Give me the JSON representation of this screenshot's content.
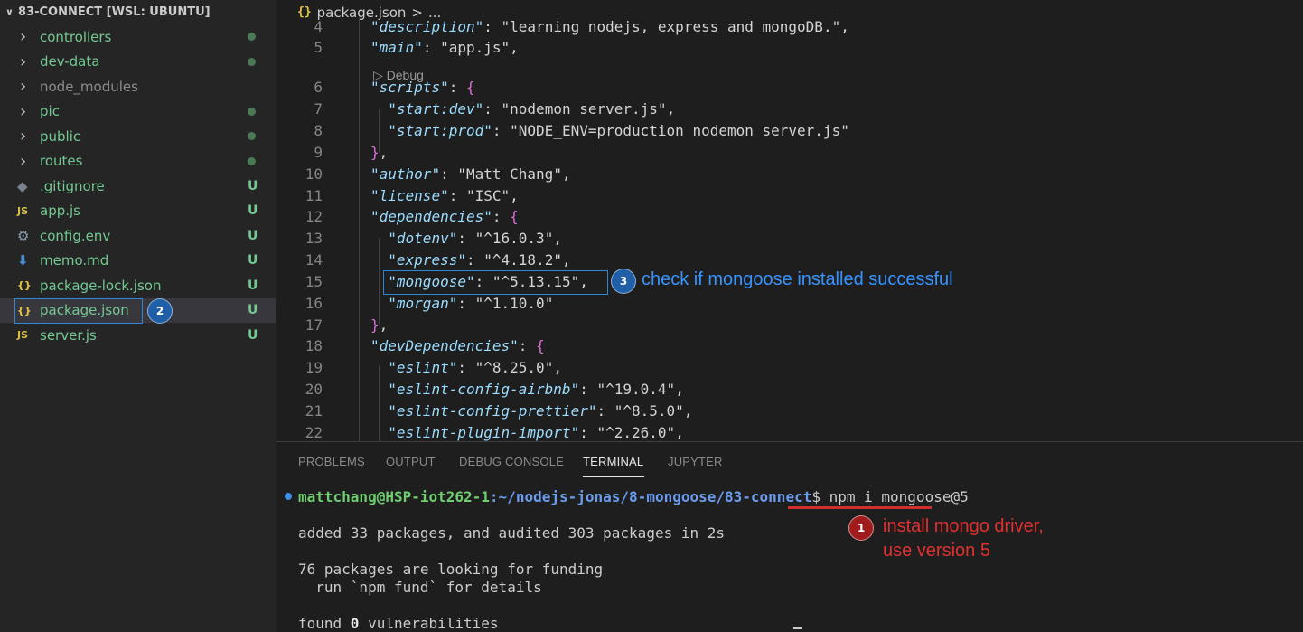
{
  "explorer": {
    "title": "83-CONNECT [WSL: UBUNTU]",
    "items": [
      {
        "name": "controllers",
        "kind": "folder",
        "status": "dot"
      },
      {
        "name": "dev-data",
        "kind": "folder",
        "status": "dot"
      },
      {
        "name": "node_modules",
        "kind": "folder",
        "status": ""
      },
      {
        "name": "pic",
        "kind": "folder",
        "status": "dot"
      },
      {
        "name": "public",
        "kind": "folder",
        "status": "dot"
      },
      {
        "name": "routes",
        "kind": "folder",
        "status": "dot"
      },
      {
        "name": ".gitignore",
        "kind": "file",
        "icon": "◆",
        "status": "U"
      },
      {
        "name": "app.js",
        "kind": "file",
        "icon": "JS",
        "status": "U"
      },
      {
        "name": "config.env",
        "kind": "file",
        "icon": "⚙",
        "status": "U"
      },
      {
        "name": "memo.md",
        "kind": "file",
        "icon": "⬇",
        "status": "U"
      },
      {
        "name": "package-lock.json",
        "kind": "file",
        "icon": "{}",
        "status": "U"
      },
      {
        "name": "package.json",
        "kind": "file",
        "icon": "{}",
        "status": "U"
      },
      {
        "name": "server.js",
        "kind": "file",
        "icon": "JS",
        "status": "U"
      }
    ]
  },
  "breadcrumb": {
    "icon": "{}",
    "file": "package.json",
    "sep": ">",
    "more": "..."
  },
  "editor": {
    "codelens": "▷ Debug",
    "lines": [
      {
        "n": "4",
        "key": "description",
        "val": "learning nodejs, express and mongoDB.",
        "tail": ","
      },
      {
        "n": "5",
        "key": "main",
        "val": "app.js",
        "tail": ","
      },
      {
        "n": "6",
        "key": "scripts",
        "open": "{"
      },
      {
        "n": "7",
        "key": "start:dev",
        "val": "nodemon server.js",
        "tail": ","
      },
      {
        "n": "8",
        "key": "start:prod",
        "val": "NODE_ENV=production nodemon server.js",
        "tail": ""
      },
      {
        "n": "9",
        "close": "}",
        "tail": ","
      },
      {
        "n": "10",
        "key": "author",
        "val": "Matt Chang",
        "tail": ","
      },
      {
        "n": "11",
        "key": "license",
        "val": "ISC",
        "tail": ","
      },
      {
        "n": "12",
        "key": "dependencies",
        "open": "{"
      },
      {
        "n": "13",
        "key": "dotenv",
        "val": "^16.0.3",
        "tail": ","
      },
      {
        "n": "14",
        "key": "express",
        "val": "^4.18.2",
        "tail": ","
      },
      {
        "n": "15",
        "key": "mongoose",
        "val": "^5.13.15",
        "tail": ","
      },
      {
        "n": "16",
        "key": "morgan",
        "val": "^1.10.0",
        "tail": ""
      },
      {
        "n": "17",
        "close": "}",
        "tail": ","
      },
      {
        "n": "18",
        "key": "devDependencies",
        "open": "{"
      },
      {
        "n": "19",
        "key": "eslint",
        "val": "^8.25.0",
        "tail": ","
      },
      {
        "n": "20",
        "key": "eslint-config-airbnb",
        "val": "^19.0.4",
        "tail": ","
      },
      {
        "n": "21",
        "key": "eslint-config-prettier",
        "val": "^8.5.0",
        "tail": ","
      },
      {
        "n": "22",
        "key": "eslint-plugin-import",
        "val": "^2.26.0",
        "tail": ","
      }
    ]
  },
  "panel": {
    "tabs": [
      "PROBLEMS",
      "OUTPUT",
      "DEBUG CONSOLE",
      "TERMINAL",
      "JUPYTER"
    ],
    "active_tab": "TERMINAL"
  },
  "terminal": {
    "user": "mattchang@HSP-iot262-1",
    "path": ":~/nodejs-jonas/8-mongoose/83-connect",
    "prompt_end": "$ ",
    "command": "npm i mongoose@5",
    "out1": "added 33 packages, and audited 303 packages in 2s",
    "out2": "76 packages are looking for funding",
    "out3": "  run `npm fund` for details",
    "out4_a": "found ",
    "out4_b": "0",
    "out4_c": " vulnerabilities"
  },
  "annotations": {
    "a1_num": "1",
    "a1_line1": "install mongo driver,",
    "a1_line2": "use version 5",
    "a1_color": "#e03030",
    "a2_num": "2",
    "a3_num": "3",
    "a3_text": "check if mongoose installed successful",
    "a3_color": "#3794ff"
  }
}
